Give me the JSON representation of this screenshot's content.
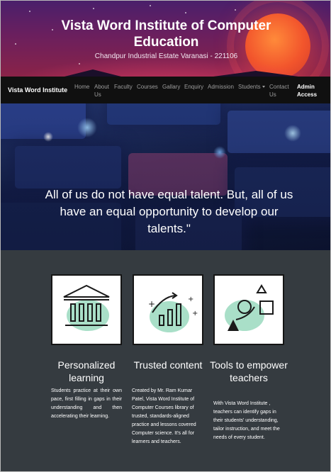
{
  "header": {
    "title": "Vista Word Institute of Computer Education",
    "address": "Chandpur Industrial Estate Varanasi - 221106"
  },
  "navbar": {
    "brand": "Vista Word Institute",
    "items": [
      "Home",
      "About Us",
      "Faculty",
      "Courses",
      "Gallary",
      "Enquiry",
      "Admission",
      "Students",
      "Contact Us",
      "Admin Access"
    ]
  },
  "hero": {
    "quote": "All of us do not have equal talent. But, all of us have an equal opportunity to develop our talents.\""
  },
  "features": [
    {
      "icon": "institution-icon",
      "title": "Personalized learning",
      "description": "Students practice at their own pace, first filling in gaps in their understanding and then accelerating their learning."
    },
    {
      "icon": "growth-chart-icon",
      "title": "Trusted content",
      "description": "Created by Mr. Ram Kumar Patel, Vista Word Institute of Computer Courses library of trusted, standards-aligned practice and lessons covered Computer science. It's all for learners and teachers."
    },
    {
      "icon": "shapes-icon",
      "title": "Tools to empower teachers",
      "description": "With Vista Word Institute , teachers can identify gaps in their students' understanding, tailor instruction, and meet the needs of every student."
    }
  ],
  "colors": {
    "navbar": "#101010",
    "features_bg": "#353b40",
    "illustration_mint": "#a9dfc8"
  }
}
